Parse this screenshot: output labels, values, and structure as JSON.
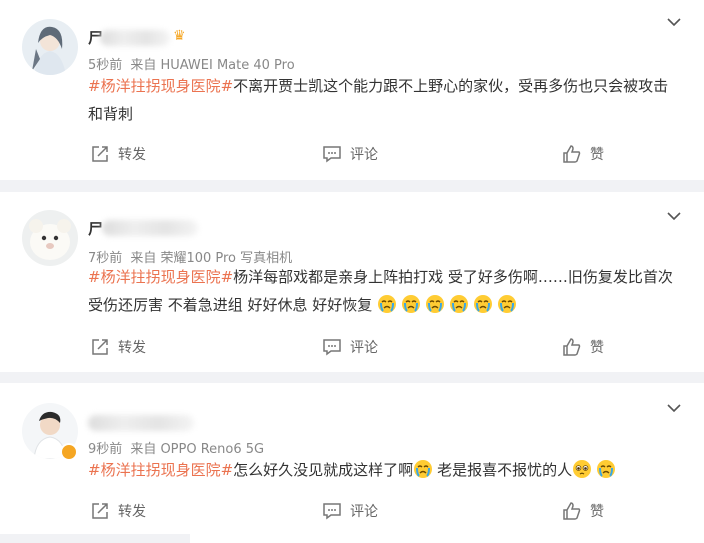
{
  "comments": [
    {
      "time": "5秒前",
      "source_prefix": "来自",
      "source": "HUAWEI Mate 40 Pro",
      "topic": "#杨洋拄拐现身医院#",
      "text_line1": "不离开贾士凯这个能力跟不上野心的家伙，受再多伤也只会被攻击",
      "text_line2": "和背刺",
      "name_visible": "尸"
    },
    {
      "time": "7秒前",
      "source_prefix": "来自",
      "source": "荣耀100 Pro 写真相机",
      "topic": "#杨洋拄拐现身医院#",
      "text_line1": "杨洋每部戏都是亲身上阵拍打戏 受了好多伤啊……旧伤复发比首次",
      "text_line2": "受伤还厉害 不着急进组 好好休息 好好恢复",
      "name_visible": "尸"
    },
    {
      "time": "9秒前",
      "source_prefix": "来自",
      "source": "OPPO Reno6 5G",
      "topic": "#杨洋拄拐现身医院#",
      "text_line1": "怎么好久没见就成这样了啊",
      "text_line1b": "老是报喜不报忧的人",
      "name_visible": ""
    }
  ],
  "actions": {
    "repost": "转发",
    "comment": "评论",
    "like": "赞"
  },
  "icons": {
    "more": "chevron-down-icon",
    "repost": "repost-icon",
    "comment": "comment-icon",
    "like": "thumbs-up-icon",
    "crying": "crying-emoji-icon",
    "pleading": "pleading-emoji-icon",
    "crown": "crown-badge-icon",
    "verified": "verified-badge-icon"
  },
  "colors": {
    "topic": "#eb7350",
    "background": "#f1f2f5",
    "badge": "#f5a623"
  }
}
